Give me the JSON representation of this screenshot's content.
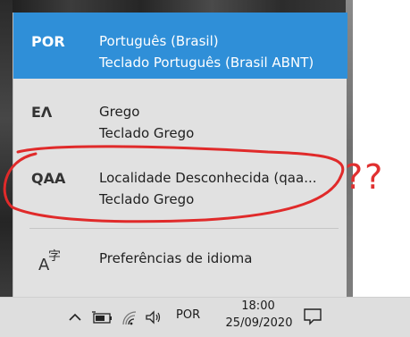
{
  "languages": [
    {
      "code": "POR",
      "name": "Português (Brasil)",
      "keyboard": "Teclado Português (Brasil ABNT)",
      "selected": true
    },
    {
      "code": "ΕΛ",
      "name": "Grego",
      "keyboard": "Teclado Grego",
      "selected": false
    },
    {
      "code": "QAA",
      "name": "Localidade Desconhecida (qaa...",
      "keyboard": "Teclado Grego",
      "selected": false
    }
  ],
  "preferences": {
    "label": "Preferências de idioma",
    "icon": "language-settings-icon"
  },
  "annotation": {
    "text": "??",
    "color": "#e03030"
  },
  "taskbar": {
    "input_indicator": "POR",
    "time": "18:00",
    "date": "25/09/2020",
    "icons": [
      "chevron-up-icon",
      "battery-icon",
      "network-icon",
      "volume-icon",
      "notification-icon"
    ]
  },
  "colors": {
    "accent": "#2f8fd8",
    "flyout_bg": "#e1e1e1",
    "taskbar_bg": "#dedede"
  }
}
